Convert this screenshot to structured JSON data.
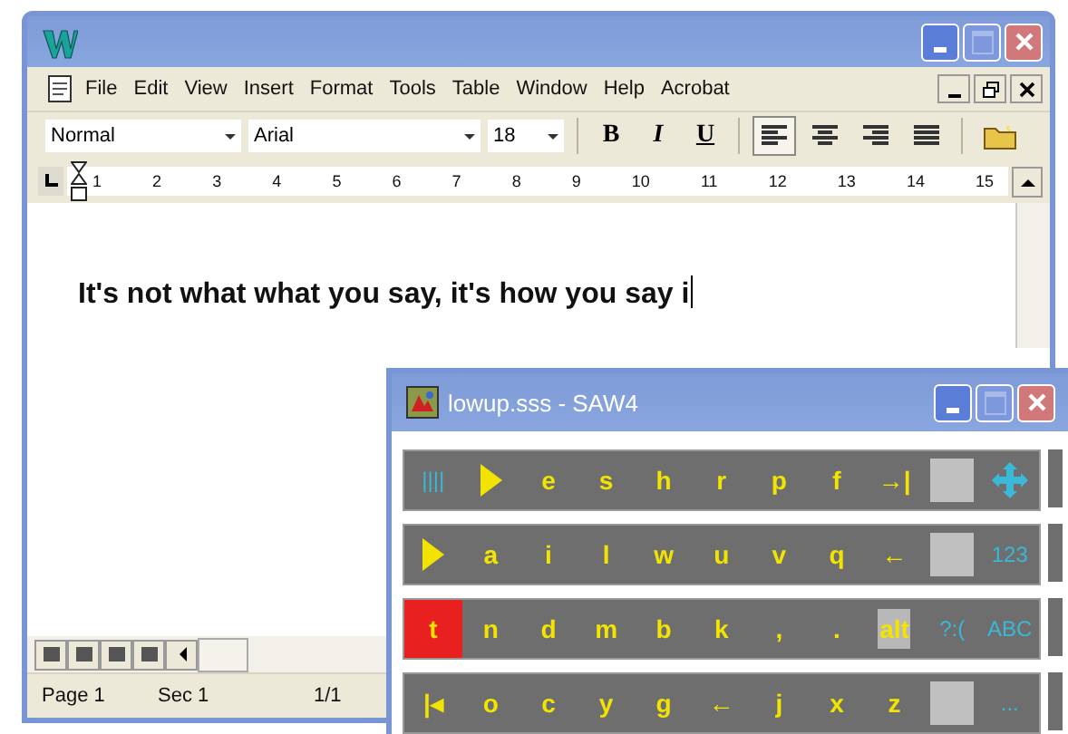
{
  "word_window": {
    "menu": [
      {
        "label": "File"
      },
      {
        "label": "Edit"
      },
      {
        "label": "View"
      },
      {
        "label": "Insert"
      },
      {
        "label": "Format"
      },
      {
        "label": "Tools"
      },
      {
        "label": "Table"
      },
      {
        "label": "Window"
      },
      {
        "label": "Help"
      },
      {
        "label": "Acrobat"
      }
    ],
    "toolbar": {
      "style": "Normal",
      "font": "Arial",
      "size": "18",
      "format_buttons": [
        {
          "label": "B",
          "kind": "bold"
        },
        {
          "label": "I",
          "kind": "italic"
        },
        {
          "label": "U",
          "kind": "underline"
        }
      ],
      "align_buttons": [
        {
          "selected": true
        },
        {
          "selected": false
        },
        {
          "selected": false
        },
        {
          "selected": false
        }
      ]
    },
    "ruler": [
      "1",
      "2",
      "3",
      "4",
      "5",
      "6",
      "7",
      "8",
      "9",
      "10",
      "11",
      "12",
      "13",
      "14",
      "15"
    ],
    "document_text": "It's not what what you say, it's how you say i",
    "status_bar": [
      "Page 1",
      "Sec 1",
      "1/1"
    ]
  },
  "saw_window": {
    "title": "lowup.sss - SAW4",
    "rows": [
      [
        {
          "kind": "command",
          "label": "||||"
        },
        {
          "kind": "arrow"
        },
        {
          "kind": "letter",
          "label": "e"
        },
        {
          "kind": "letter",
          "label": "s"
        },
        {
          "kind": "letter",
          "label": "h"
        },
        {
          "kind": "letter",
          "label": "r"
        },
        {
          "kind": "letter",
          "label": "p"
        },
        {
          "kind": "letter",
          "label": "f"
        },
        {
          "kind": "letter",
          "label": "→|"
        },
        {
          "kind": "blank"
        },
        {
          "kind": "move"
        }
      ],
      [
        {
          "kind": "arrow"
        },
        {
          "kind": "letter",
          "label": "a"
        },
        {
          "kind": "letter",
          "label": "i"
        },
        {
          "kind": "letter",
          "label": "l"
        },
        {
          "kind": "letter",
          "label": "w"
        },
        {
          "kind": "letter",
          "label": "u"
        },
        {
          "kind": "letter",
          "label": "v"
        },
        {
          "kind": "letter",
          "label": "q"
        },
        {
          "kind": "letter",
          "label": "←"
        },
        {
          "kind": "blank"
        },
        {
          "kind": "command",
          "label": "123"
        }
      ],
      [
        {
          "kind": "letter",
          "label": "t",
          "selected": true
        },
        {
          "kind": "letter",
          "label": "n"
        },
        {
          "kind": "letter",
          "label": "d"
        },
        {
          "kind": "letter",
          "label": "m"
        },
        {
          "kind": "letter",
          "label": "b"
        },
        {
          "kind": "letter",
          "label": "k"
        },
        {
          "kind": "letter",
          "label": ","
        },
        {
          "kind": "letter",
          "label": "."
        },
        {
          "kind": "toggle",
          "label": "alt"
        },
        {
          "kind": "command",
          "label": "?:("
        },
        {
          "kind": "command",
          "label": "ABC"
        }
      ],
      [
        {
          "kind": "letter",
          "label": "|◂"
        },
        {
          "kind": "letter",
          "label": "o"
        },
        {
          "kind": "letter",
          "label": "c"
        },
        {
          "kind": "letter",
          "label": "y"
        },
        {
          "kind": "letter",
          "label": "g"
        },
        {
          "kind": "letter",
          "label": "←"
        },
        {
          "kind": "letter",
          "label": "j"
        },
        {
          "kind": "letter",
          "label": "x"
        },
        {
          "kind": "letter",
          "label": "z"
        },
        {
          "kind": "blank"
        },
        {
          "kind": "command",
          "label": "..."
        }
      ]
    ]
  }
}
